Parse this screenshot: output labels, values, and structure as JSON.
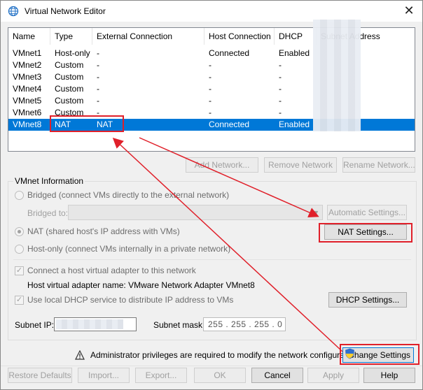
{
  "window": {
    "title": "Virtual Network Editor",
    "close_glyph": "✕"
  },
  "list": {
    "columns": [
      "Name",
      "Type",
      "External Connection",
      "Host Connection",
      "DHCP",
      "Subnet Address"
    ],
    "rows": [
      {
        "name": "VMnet1",
        "type": "Host-only",
        "external": "-",
        "host": "Connected",
        "dhcp": "Enabled"
      },
      {
        "name": "VMnet2",
        "type": "Custom",
        "external": "-",
        "host": "-",
        "dhcp": "-"
      },
      {
        "name": "VMnet3",
        "type": "Custom",
        "external": "-",
        "host": "-",
        "dhcp": "-"
      },
      {
        "name": "VMnet4",
        "type": "Custom",
        "external": "-",
        "host": "-",
        "dhcp": "-"
      },
      {
        "name": "VMnet5",
        "type": "Custom",
        "external": "-",
        "host": "-",
        "dhcp": "-"
      },
      {
        "name": "VMnet6",
        "type": "Custom",
        "external": "-",
        "host": "-",
        "dhcp": "-"
      },
      {
        "name": "VMnet8",
        "type": "NAT",
        "external": "NAT",
        "host": "Connected",
        "dhcp": "Enabled"
      }
    ],
    "selected_index": 6
  },
  "list_buttons": {
    "add": "Add Network...",
    "remove": "Remove Network",
    "rename": "Rename Network..."
  },
  "vmnet_info": {
    "title": "VMnet Information",
    "bridged": "Bridged (connect VMs directly to the external network)",
    "bridged_to": "Bridged to:",
    "automatic_settings": "Automatic Settings...",
    "nat": "NAT (shared host's IP address with VMs)",
    "nat_settings": "NAT Settings...",
    "host_only": "Host-only (connect VMs internally in a private network)",
    "connect_adapter": "Connect a host virtual adapter to this network",
    "adapter_name": "Host virtual adapter name: VMware Network Adapter VMnet8",
    "use_dhcp": "Use local DHCP service to distribute IP address to VMs",
    "dhcp_settings": "DHCP Settings...",
    "subnet_ip_label": "Subnet IP:",
    "subnet_mask_label": "Subnet mask:",
    "subnet_mask_value": "255 . 255 . 255 .  0"
  },
  "admin": {
    "message": "Administrator privileges are required to modify the network configuration.",
    "change_settings": "Change Settings"
  },
  "footer": {
    "restore": "Restore Defaults",
    "import": "Import...",
    "export": "Export...",
    "ok": "OK",
    "cancel": "Cancel",
    "apply": "Apply",
    "help": "Help"
  },
  "colors": {
    "selection": "#0078d7",
    "annotation": "#e0202a",
    "disabled_text": "#a0a0a0"
  },
  "icons": [
    "network-globe-icon",
    "close-icon",
    "warning-icon",
    "shield-icon",
    "dropdown-arrow-icon"
  ]
}
